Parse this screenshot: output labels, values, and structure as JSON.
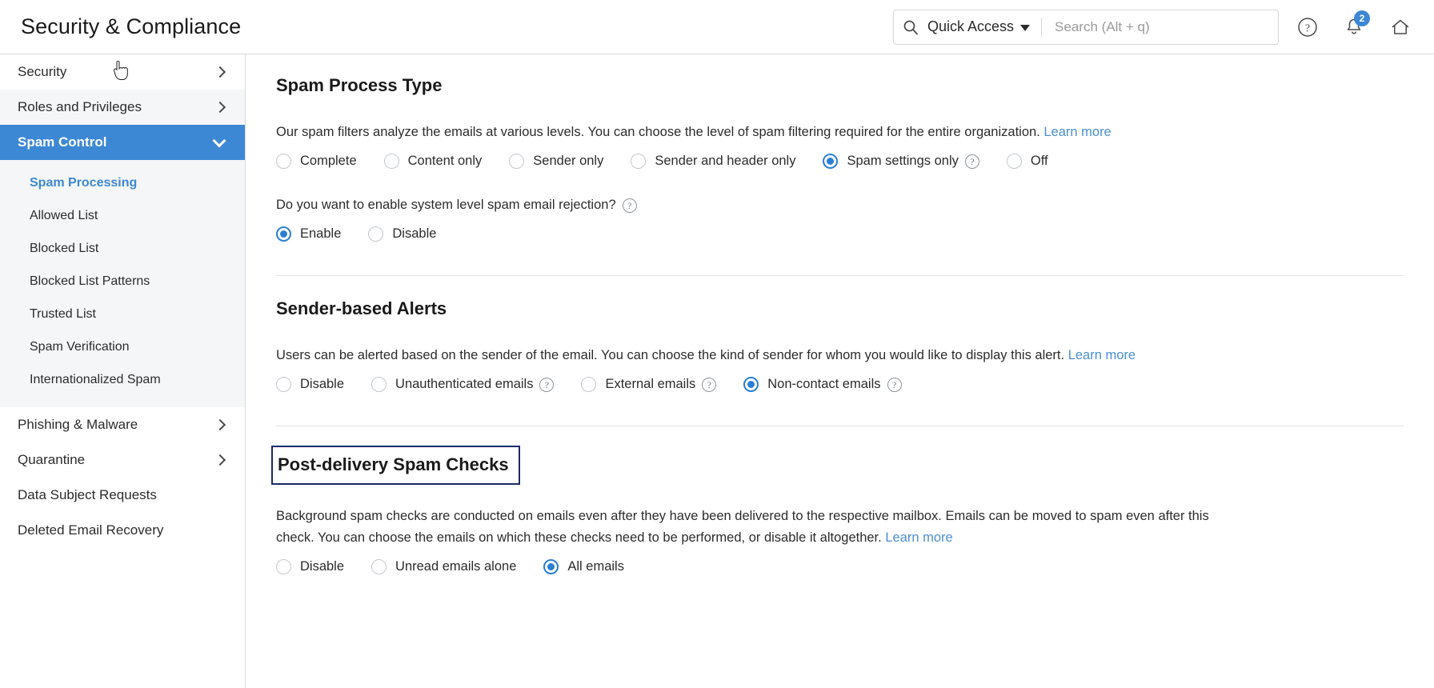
{
  "header": {
    "title": "Security & Compliance",
    "quick_access_label": "Quick Access",
    "search_placeholder": "Search (Alt + q)",
    "search_value": "",
    "help_icon": "help-circle-icon",
    "notifications_icon": "bell-icon",
    "notifications_count": "2",
    "home_icon": "home-icon",
    "accent_color": "#3c88d4"
  },
  "sidebar": {
    "top_items": [
      {
        "label": "Security",
        "expandable": true,
        "active": false
      },
      {
        "label": "Roles and Privileges",
        "expandable": true,
        "active": false
      },
      {
        "label": "Spam Control",
        "expandable": true,
        "active": true
      }
    ],
    "sub_items": [
      {
        "label": "Spam Processing",
        "current": true
      },
      {
        "label": "Allowed List",
        "current": false
      },
      {
        "label": "Blocked List",
        "current": false
      },
      {
        "label": "Blocked List Patterns",
        "current": false
      },
      {
        "label": "Trusted List",
        "current": false
      },
      {
        "label": "Spam Verification",
        "current": false
      },
      {
        "label": "Internationalized Spam",
        "current": false
      }
    ],
    "bottom_items": [
      {
        "label": "Phishing & Malware",
        "expandable": true
      },
      {
        "label": "Quarantine",
        "expandable": true
      },
      {
        "label": "Data Subject Requests",
        "expandable": false
      },
      {
        "label": "Deleted Email Recovery",
        "expandable": false
      }
    ]
  },
  "main": {
    "spam_process_type": {
      "title": "Spam Process Type",
      "description": "Our spam filters analyze the emails at various levels. You can choose the level of spam filtering required for the entire organization.",
      "learn_more": "Learn more",
      "options": [
        {
          "label": "Complete",
          "selected": false,
          "help": false
        },
        {
          "label": "Content only",
          "selected": false,
          "help": false
        },
        {
          "label": "Sender only",
          "selected": false,
          "help": false
        },
        {
          "label": "Sender and header only",
          "selected": false,
          "help": false
        },
        {
          "label": "Spam settings only",
          "selected": true,
          "help": true
        },
        {
          "label": "Off",
          "selected": false,
          "help": false
        }
      ],
      "rejection_question": "Do you want to enable system level spam email rejection?",
      "rejection_help": true,
      "rejection_options": [
        {
          "label": "Enable",
          "selected": true,
          "help": false
        },
        {
          "label": "Disable",
          "selected": false,
          "help": false
        }
      ]
    },
    "sender_based_alerts": {
      "title": "Sender-based Alerts",
      "description": "Users can be alerted based on the sender of the email. You can choose the kind of sender for whom you would like to display this alert.",
      "learn_more": "Learn more",
      "options": [
        {
          "label": "Disable",
          "selected": false,
          "help": false
        },
        {
          "label": "Unauthenticated emails",
          "selected": false,
          "help": true
        },
        {
          "label": "External emails",
          "selected": false,
          "help": true
        },
        {
          "label": "Non-contact emails",
          "selected": true,
          "help": true
        }
      ]
    },
    "post_delivery_spam_checks": {
      "title": "Post-delivery Spam Checks",
      "highlighted": true,
      "highlight_color": "#1b2a6b",
      "description": "Background spam checks are conducted on emails even after they have been delivered to the respective mailbox. Emails can be moved to spam even after this check. You can choose the emails on which these checks need to be performed, or disable it altogether.",
      "learn_more": "Learn more",
      "options": [
        {
          "label": "Disable",
          "selected": false,
          "help": false
        },
        {
          "label": "Unread emails alone",
          "selected": false,
          "help": false
        },
        {
          "label": "All emails",
          "selected": true,
          "help": false
        }
      ]
    }
  }
}
